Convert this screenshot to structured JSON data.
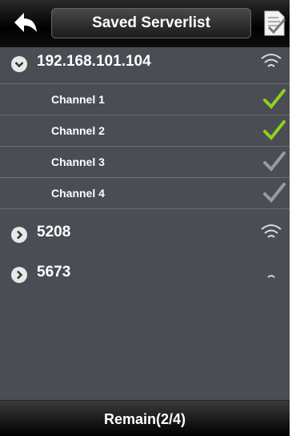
{
  "header": {
    "title": "Saved Serverlist"
  },
  "servers": [
    {
      "name": "192.168.101.104",
      "expanded": true,
      "signal": "strong",
      "channels": [
        {
          "label": "Channel 1",
          "checked": true
        },
        {
          "label": "Channel 2",
          "checked": true
        },
        {
          "label": "Channel 3",
          "checked": false
        },
        {
          "label": "Channel 4",
          "checked": false
        }
      ]
    },
    {
      "name": "5208",
      "expanded": false,
      "signal": "strong"
    },
    {
      "name": "5673",
      "expanded": false,
      "signal": "weak"
    }
  ],
  "footer": {
    "status": "Remain(2/4)"
  },
  "colors": {
    "check_on": "#8cd21e",
    "check_off": "#9a9a9a"
  }
}
